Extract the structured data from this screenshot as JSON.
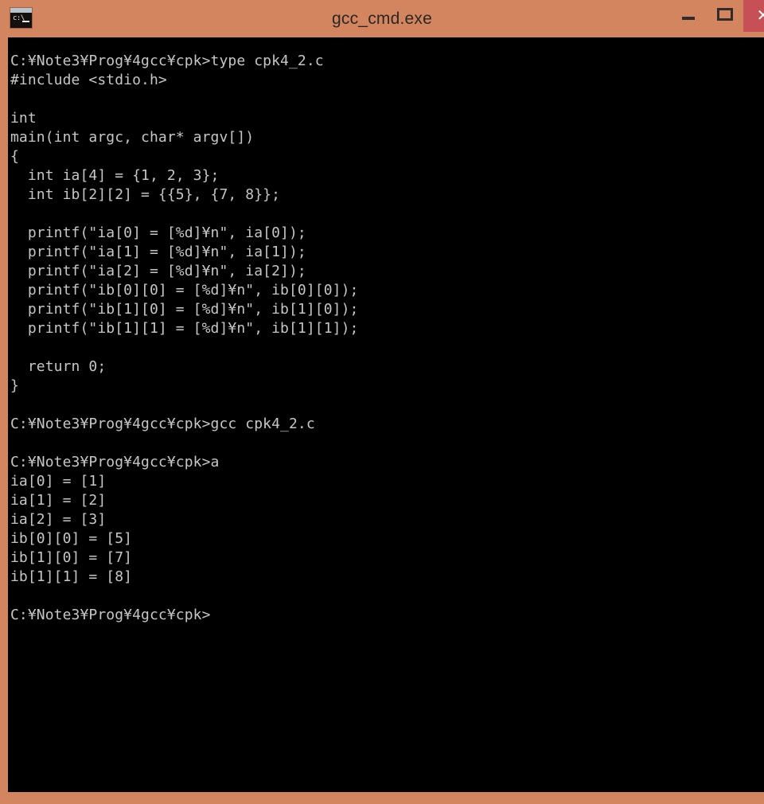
{
  "window": {
    "title": "gcc_cmd.exe",
    "icon": "console-window-icon",
    "icon_prompt_glyph": "c:\\",
    "frame_color": "#d3855f",
    "console_bg": "#000000",
    "console_fg": "#c6c6c6",
    "close_button_color": "#c75056"
  },
  "controls": {
    "minimize_label": "–",
    "maximize_label": "□",
    "close_label": "✕"
  },
  "console": {
    "prompt": "C:¥Note3¥Prog¥4gcc¥cpk>",
    "commands": [
      "type cpk4_2.c",
      "gcc cpk4_2.c",
      "a"
    ],
    "source_file": "cpk4_2.c",
    "program_output": [
      "ia[0] = [1]",
      "ia[1] = [2]",
      "ia[2] = [3]",
      "ib[0][0] = [5]",
      "ib[1][0] = [7]",
      "ib[1][1] = [8]"
    ],
    "source_listing": [
      "#include <stdio.h>",
      "",
      "int",
      "main(int argc, char* argv[])",
      "{",
      "  int ia[4] = {1, 2, 3};",
      "  int ib[2][2] = {{5}, {7, 8}};",
      "",
      "  printf(\"ia[0] = [%d]¥n\", ia[0]);",
      "  printf(\"ia[1] = [%d]¥n\", ia[1]);",
      "  printf(\"ia[2] = [%d]¥n\", ia[2]);",
      "  printf(\"ib[0][0] = [%d]¥n\", ib[0][0]);",
      "  printf(\"ib[1][0] = [%d]¥n\", ib[1][0]);",
      "  printf(\"ib[1][1] = [%d]¥n\", ib[1][1]);",
      "",
      "  return 0;",
      "}"
    ],
    "screen_text": "C:¥Note3¥Prog¥4gcc¥cpk>type cpk4_2.c\n#include <stdio.h>\n\nint\nmain(int argc, char* argv[])\n{\n  int ia[4] = {1, 2, 3};\n  int ib[2][2] = {{5}, {7, 8}};\n\n  printf(\"ia[0] = [%d]¥n\", ia[0]);\n  printf(\"ia[1] = [%d]¥n\", ia[1]);\n  printf(\"ia[2] = [%d]¥n\", ia[2]);\n  printf(\"ib[0][0] = [%d]¥n\", ib[0][0]);\n  printf(\"ib[1][0] = [%d]¥n\", ib[1][0]);\n  printf(\"ib[1][1] = [%d]¥n\", ib[1][1]);\n\n  return 0;\n}\n\nC:¥Note3¥Prog¥4gcc¥cpk>gcc cpk4_2.c\n\nC:¥Note3¥Prog¥4gcc¥cpk>a\nia[0] = [1]\nia[1] = [2]\nia[2] = [3]\nib[0][0] = [5]\nib[1][0] = [7]\nib[1][1] = [8]\n\nC:¥Note3¥Prog¥4gcc¥cpk>"
  }
}
